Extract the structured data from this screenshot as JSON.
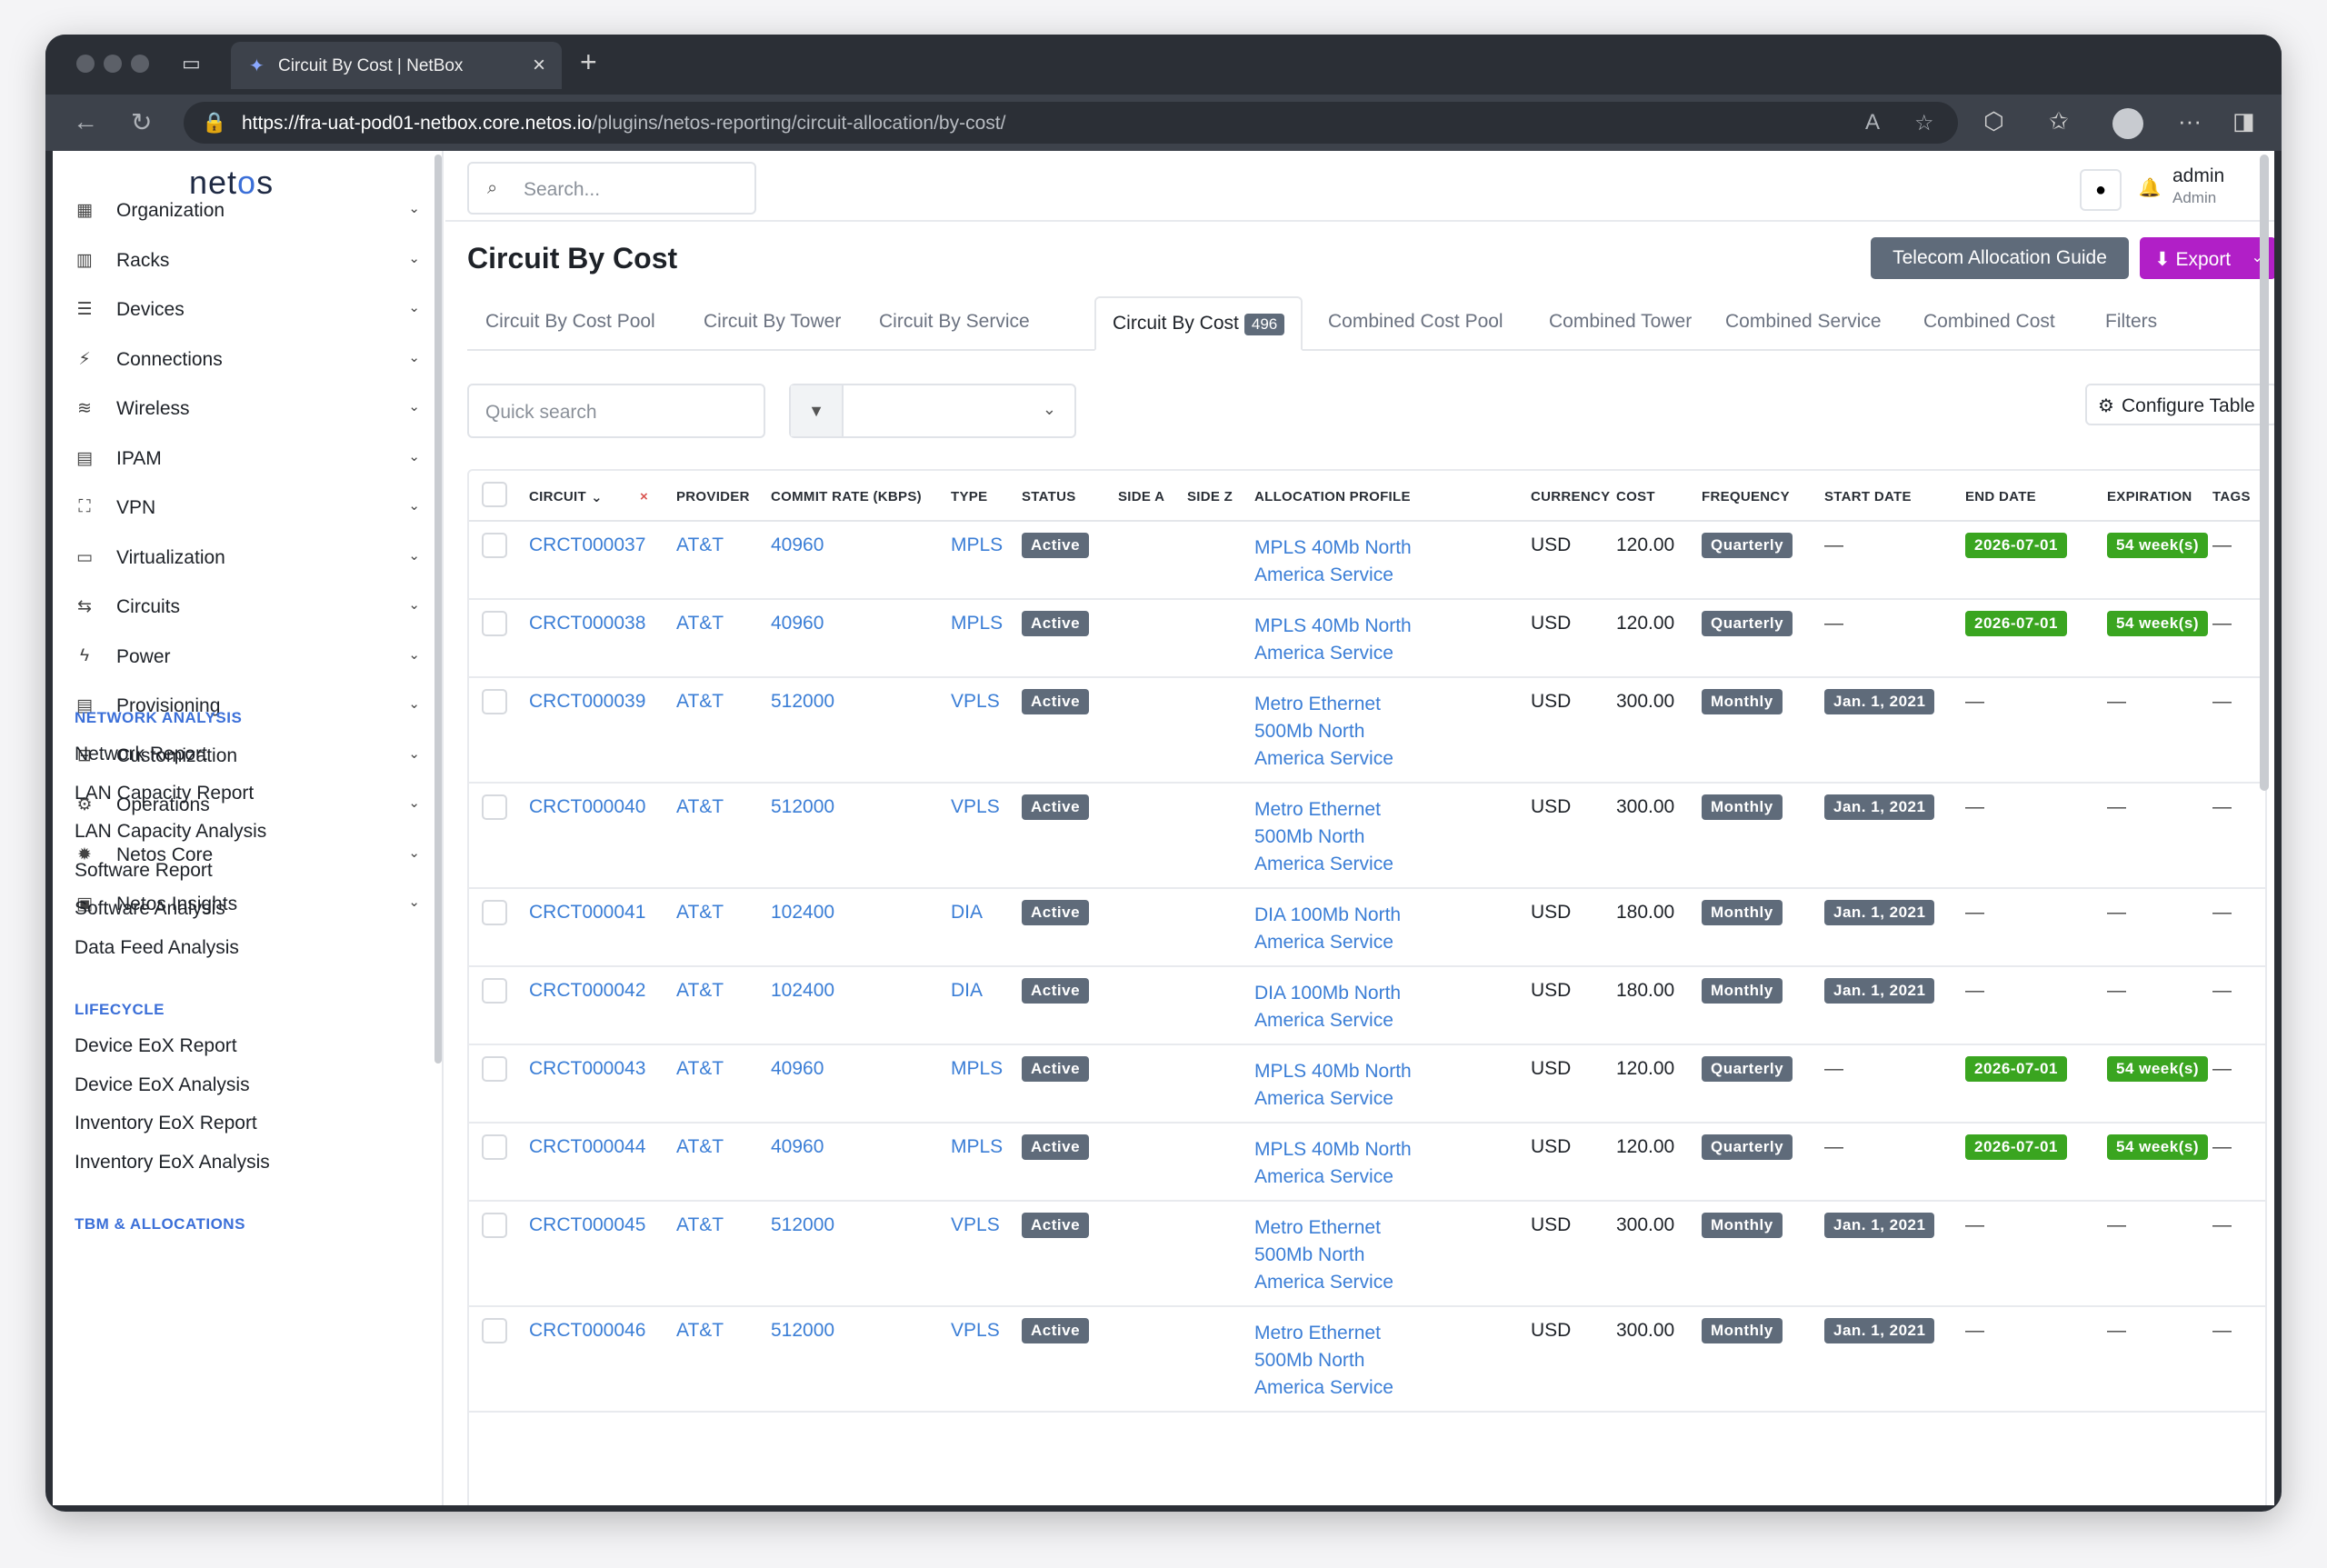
{
  "browser": {
    "tab_title": "Circuit By Cost | NetBox",
    "url_host": "https://fra-uat-pod01-netbox.core.netos.io",
    "url_path": "/plugins/netos-reporting/circuit-allocation/by-cost/"
  },
  "sidebar": {
    "logo": "netos",
    "items": [
      {
        "label": "Organization",
        "icon": "building-icon"
      },
      {
        "label": "Racks",
        "icon": "rack-icon"
      },
      {
        "label": "Devices",
        "icon": "server-icon"
      },
      {
        "label": "Connections",
        "icon": "plug-icon"
      },
      {
        "label": "Wireless",
        "icon": "wifi-icon"
      },
      {
        "label": "IPAM",
        "icon": "network-icon"
      },
      {
        "label": "VPN",
        "icon": "vpn-icon"
      },
      {
        "label": "Virtualization",
        "icon": "monitor-icon"
      },
      {
        "label": "Circuits",
        "icon": "circuit-icon"
      },
      {
        "label": "Power",
        "icon": "bolt-icon"
      },
      {
        "label": "Provisioning",
        "icon": "file-icon"
      },
      {
        "label": "Customization",
        "icon": "toolbox-icon"
      },
      {
        "label": "Operations",
        "icon": "gears-icon"
      },
      {
        "label": "Netos Core",
        "icon": "gear-icon"
      },
      {
        "label": "Netos Insights",
        "icon": "chart-icon"
      }
    ],
    "sections": [
      {
        "heading": "NETWORK ANALYSIS",
        "links": [
          "Network Report",
          "LAN Capacity Report",
          "LAN Capacity Analysis",
          "Software Report",
          "Software Analysis",
          "Data Feed Analysis"
        ]
      },
      {
        "heading": "LIFECYCLE",
        "links": [
          "Device EoX Report",
          "Device EoX Analysis",
          "Inventory EoX Report",
          "Inventory EoX Analysis"
        ]
      },
      {
        "heading": "TBM & ALLOCATIONS",
        "links": []
      }
    ]
  },
  "header": {
    "search_placeholder": "Search...",
    "user_name": "admin",
    "user_role": "Admin"
  },
  "page": {
    "title": "Circuit By Cost",
    "guide_button": "Telecom Allocation Guide",
    "export_button": "Export",
    "tabs": [
      {
        "label": "Circuit By Cost Pool"
      },
      {
        "label": "Circuit By Tower"
      },
      {
        "label": "Circuit By Service"
      },
      {
        "label": "Circuit By Cost",
        "count": "496",
        "active": true
      },
      {
        "label": "Combined Cost Pool"
      },
      {
        "label": "Combined Tower"
      },
      {
        "label": "Combined Service"
      },
      {
        "label": "Combined Cost"
      },
      {
        "label": "Filters"
      }
    ],
    "quick_search_placeholder": "Quick search",
    "configure_button": "Configure Table"
  },
  "table": {
    "columns": [
      "CIRCUIT",
      "PROVIDER",
      "COMMIT RATE (KBPS)",
      "TYPE",
      "STATUS",
      "SIDE A",
      "SIDE Z",
      "ALLOCATION PROFILE",
      "CURRENCY",
      "COST",
      "FREQUENCY",
      "START DATE",
      "END DATE",
      "EXPIRATION",
      "TAGS"
    ],
    "rows": [
      {
        "circuit": "CRCT000037",
        "provider": "AT&T",
        "rate": "40960",
        "type": "MPLS",
        "status": "Active",
        "profile": "MPLS 40Mb North America Service",
        "currency": "USD",
        "cost": "120.00",
        "frequency": "Quarterly",
        "start": "—",
        "end": "2026-07-01",
        "expiration": "54 week(s)",
        "tags": "—"
      },
      {
        "circuit": "CRCT000038",
        "provider": "AT&T",
        "rate": "40960",
        "type": "MPLS",
        "status": "Active",
        "profile": "MPLS 40Mb North America Service",
        "currency": "USD",
        "cost": "120.00",
        "frequency": "Quarterly",
        "start": "—",
        "end": "2026-07-01",
        "expiration": "54 week(s)",
        "tags": "—"
      },
      {
        "circuit": "CRCT000039",
        "provider": "AT&T",
        "rate": "512000",
        "type": "VPLS",
        "status": "Active",
        "profile": "Metro Ethernet 500Mb North America Service",
        "currency": "USD",
        "cost": "300.00",
        "frequency": "Monthly",
        "start": "Jan. 1, 2021",
        "end": "—",
        "expiration": "—",
        "tags": "—"
      },
      {
        "circuit": "CRCT000040",
        "provider": "AT&T",
        "rate": "512000",
        "type": "VPLS",
        "status": "Active",
        "profile": "Metro Ethernet 500Mb North America Service",
        "currency": "USD",
        "cost": "300.00",
        "frequency": "Monthly",
        "start": "Jan. 1, 2021",
        "end": "—",
        "expiration": "—",
        "tags": "—"
      },
      {
        "circuit": "CRCT000041",
        "provider": "AT&T",
        "rate": "102400",
        "type": "DIA",
        "status": "Active",
        "profile": "DIA 100Mb North America Service",
        "currency": "USD",
        "cost": "180.00",
        "frequency": "Monthly",
        "start": "Jan. 1, 2021",
        "end": "—",
        "expiration": "—",
        "tags": "—"
      },
      {
        "circuit": "CRCT000042",
        "provider": "AT&T",
        "rate": "102400",
        "type": "DIA",
        "status": "Active",
        "profile": "DIA 100Mb North America Service",
        "currency": "USD",
        "cost": "180.00",
        "frequency": "Monthly",
        "start": "Jan. 1, 2021",
        "end": "—",
        "expiration": "—",
        "tags": "—"
      },
      {
        "circuit": "CRCT000043",
        "provider": "AT&T",
        "rate": "40960",
        "type": "MPLS",
        "status": "Active",
        "profile": "MPLS 40Mb North America Service",
        "currency": "USD",
        "cost": "120.00",
        "frequency": "Quarterly",
        "start": "—",
        "end": "2026-07-01",
        "expiration": "54 week(s)",
        "tags": "—"
      },
      {
        "circuit": "CRCT000044",
        "provider": "AT&T",
        "rate": "40960",
        "type": "MPLS",
        "status": "Active",
        "profile": "MPLS 40Mb North America Service",
        "currency": "USD",
        "cost": "120.00",
        "frequency": "Quarterly",
        "start": "—",
        "end": "2026-07-01",
        "expiration": "54 week(s)",
        "tags": "—"
      },
      {
        "circuit": "CRCT000045",
        "provider": "AT&T",
        "rate": "512000",
        "type": "VPLS",
        "status": "Active",
        "profile": "Metro Ethernet 500Mb North America Service",
        "currency": "USD",
        "cost": "300.00",
        "frequency": "Monthly",
        "start": "Jan. 1, 2021",
        "end": "—",
        "expiration": "—",
        "tags": "—"
      },
      {
        "circuit": "CRCT000046",
        "provider": "AT&T",
        "rate": "512000",
        "type": "VPLS",
        "status": "Active",
        "profile": "Metro Ethernet 500Mb North America Service",
        "currency": "USD",
        "cost": "300.00",
        "frequency": "Monthly",
        "start": "Jan. 1, 2021",
        "end": "—",
        "expiration": "—",
        "tags": "—"
      }
    ]
  },
  "colors": {
    "accent": "#3b7ed6",
    "export": "#b11fc7",
    "badge_gray": "#5f6b7a",
    "badge_green": "#3aa520"
  }
}
